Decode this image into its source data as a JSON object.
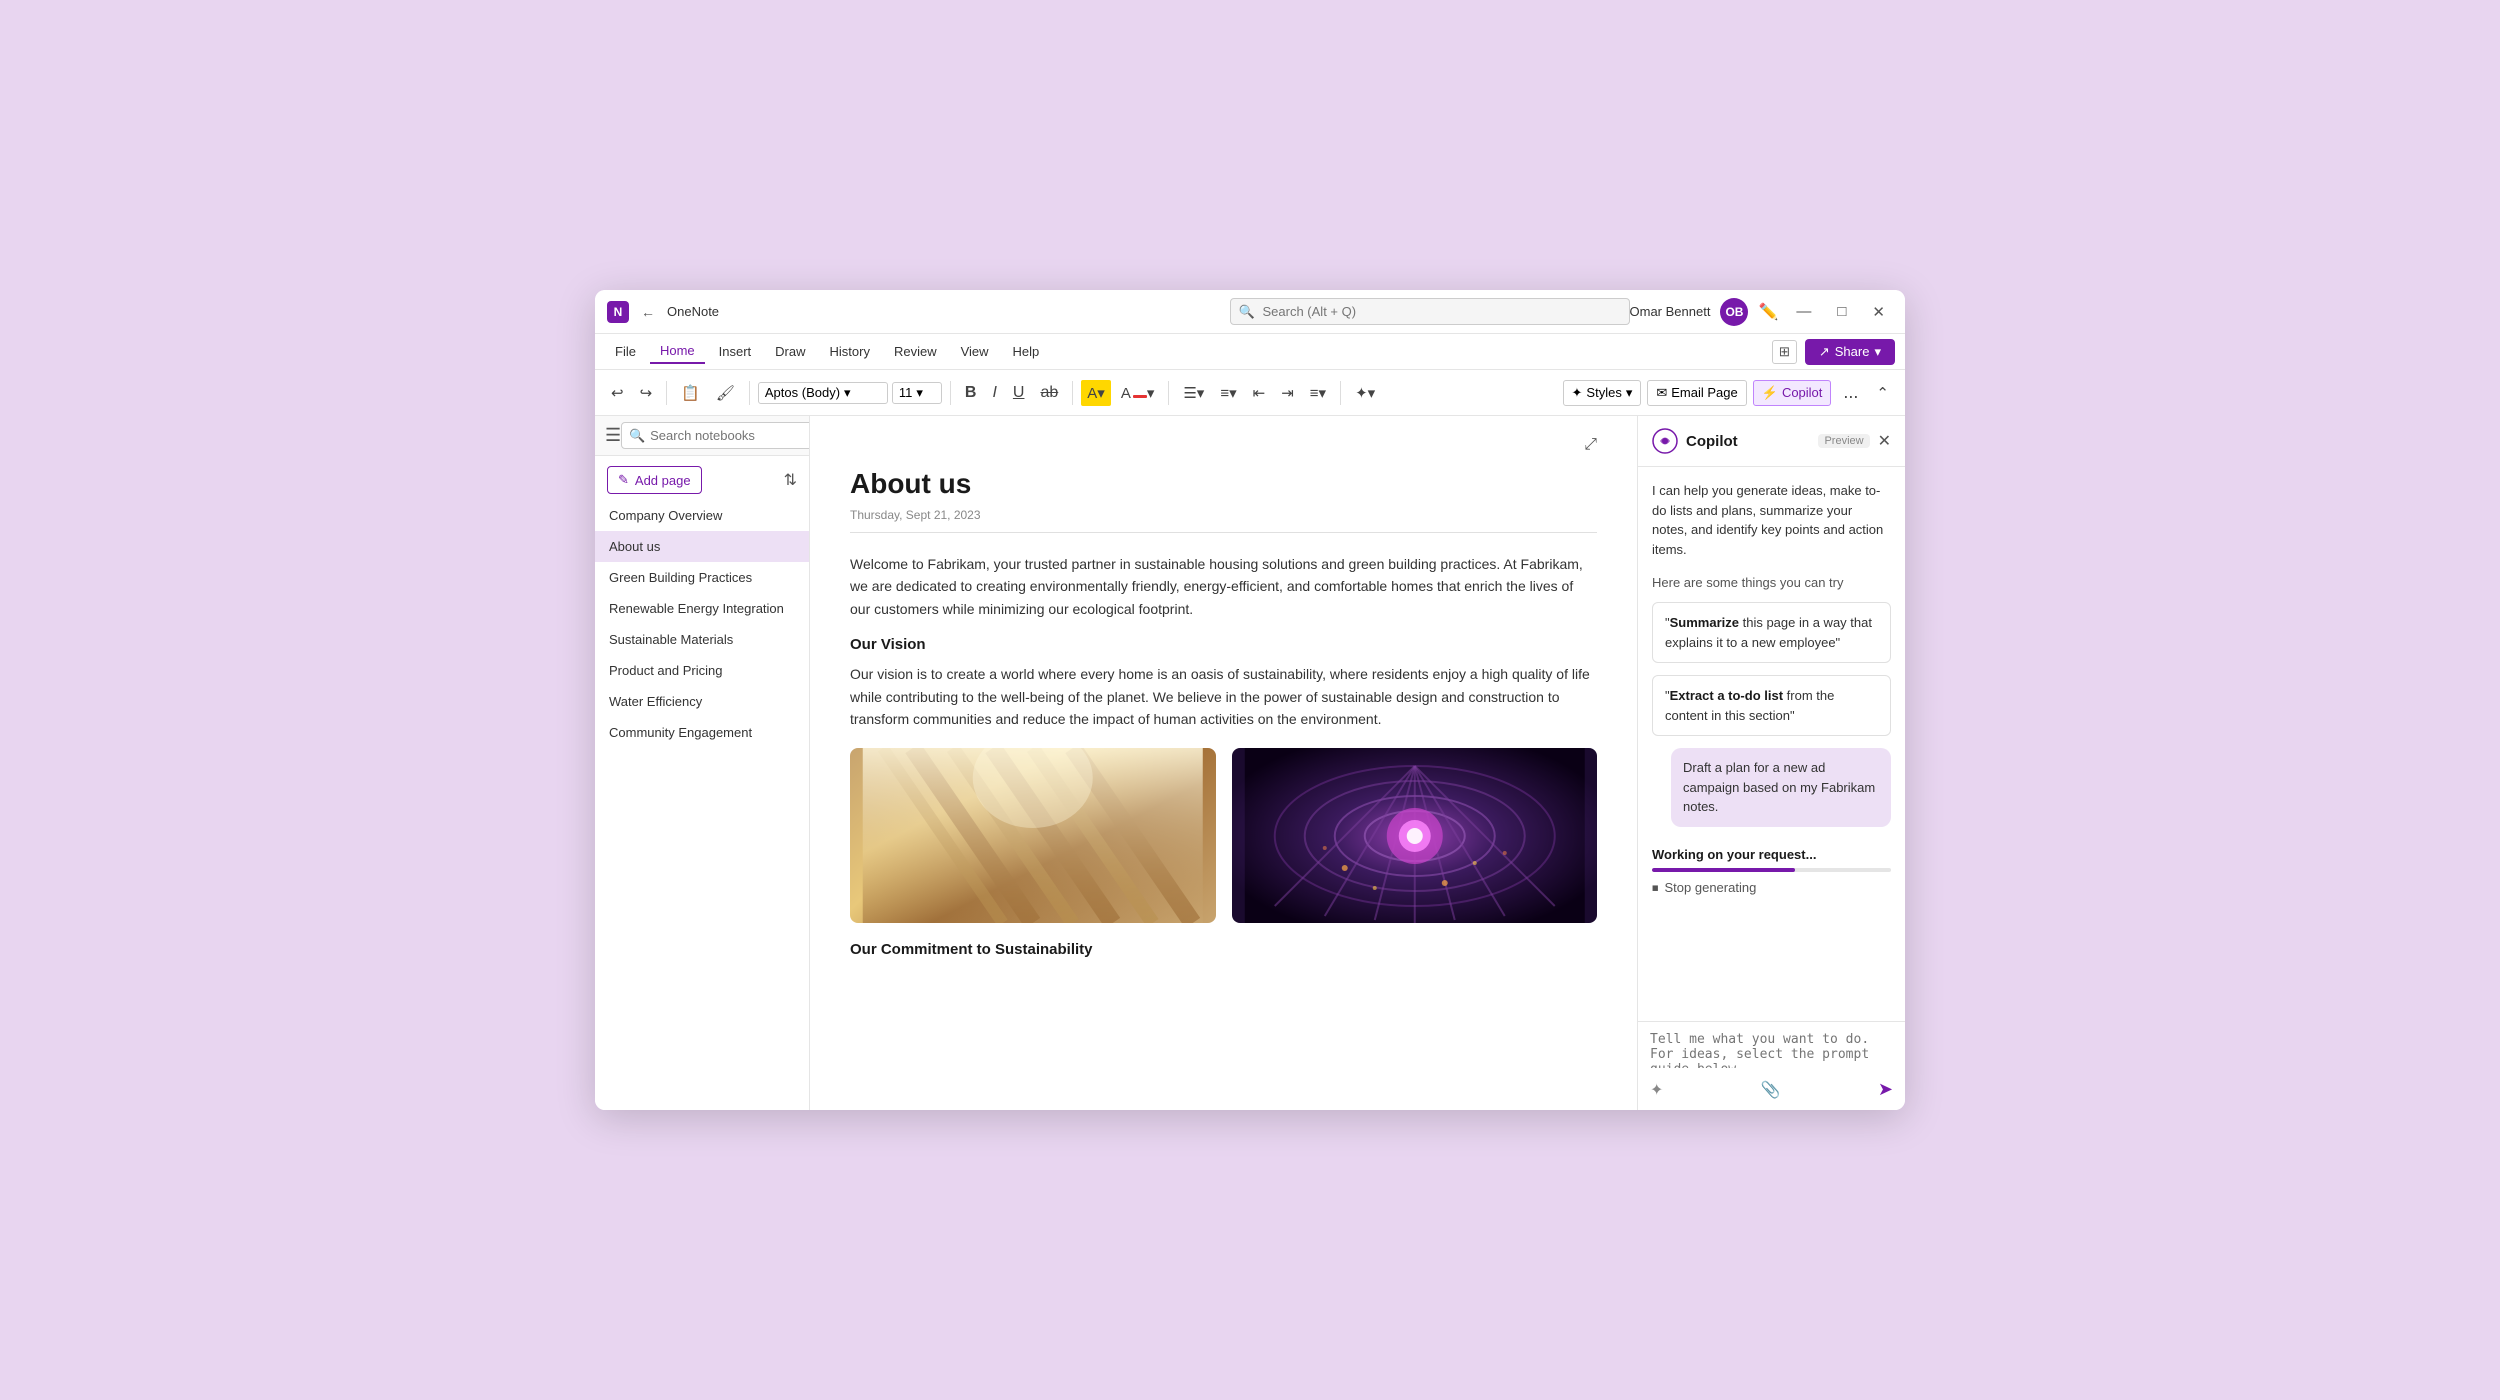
{
  "titleBar": {
    "appName": "OneNote",
    "backBtn": "←",
    "search": {
      "placeholder": "Search (Alt + Q)"
    },
    "userName": "Omar Bennett",
    "winBtns": {
      "minimize": "—",
      "maximize": "□",
      "close": "✕"
    }
  },
  "menuBar": {
    "items": [
      "File",
      "Home",
      "Insert",
      "Draw",
      "History",
      "Review",
      "View",
      "Help"
    ],
    "activeItem": "Home",
    "share": "Share"
  },
  "ribbon": {
    "fontFamily": "Aptos (Body)",
    "fontSize": "11",
    "buttons": {
      "bold": "B",
      "italic": "I",
      "underline": "U",
      "strikethrough": "ab",
      "styles": "Styles",
      "emailPage": "Email Page",
      "copilot": "Copilot",
      "more": "..."
    }
  },
  "topBar": {
    "searchNotebooks": {
      "placeholder": "Search notebooks"
    }
  },
  "sidebar": {
    "addPageBtn": "Add page",
    "pages": [
      {
        "label": "Company Overview",
        "active": false
      },
      {
        "label": "About us",
        "active": true
      },
      {
        "label": "Green Building Practices",
        "active": false
      },
      {
        "label": "Renewable Energy Integration",
        "active": false
      },
      {
        "label": "Sustainable Materials",
        "active": false
      },
      {
        "label": "Product and Pricing",
        "active": false
      },
      {
        "label": "Water Efficiency",
        "active": false
      },
      {
        "label": "Community Engagement",
        "active": false
      }
    ]
  },
  "noteEditor": {
    "title": "About us",
    "date": "Thursday, Sept 21, 2023",
    "paragraphs": [
      "Welcome to Fabrikam, your trusted partner in sustainable housing solutions and green building practices. At Fabrikam, we are dedicated to creating environmentally friendly, energy-efficient, and comfortable homes that enrich the lives of our customers while minimizing our ecological footprint.",
      "Our Vision",
      "Our vision is to create a world where every home is an oasis of sustainability, where residents enjoy a high quality of life while contributing to the well-being of the planet. We believe in the power of sustainable design and construction to transform communities and reduce the impact of human activities on the environment.",
      "Our Commitment to Sustainability"
    ]
  },
  "copilot": {
    "title": "Copilot",
    "preview": "Preview",
    "intro": "I can help you generate ideas, make to-do lists and plans, summarize your notes, and identify key points and action items.",
    "tryLabel": "Here are some things you can try",
    "suggestions": [
      {
        "boldPart": "Summarize",
        "rest": " this page in a way that explains it to a new employee\""
      },
      {
        "boldPart": "Extract a to-do list",
        "rest": " from the content in this section\""
      }
    ],
    "userMsg": "Draft a plan for a new ad campaign based on my Fabrikam notes.",
    "workingLabel": "Working on your request...",
    "stopGenerating": "Stop generating",
    "inputPlaceholder": "Tell me what you want to do. For ideas, select the prompt guide below...",
    "progressPercent": 60
  }
}
